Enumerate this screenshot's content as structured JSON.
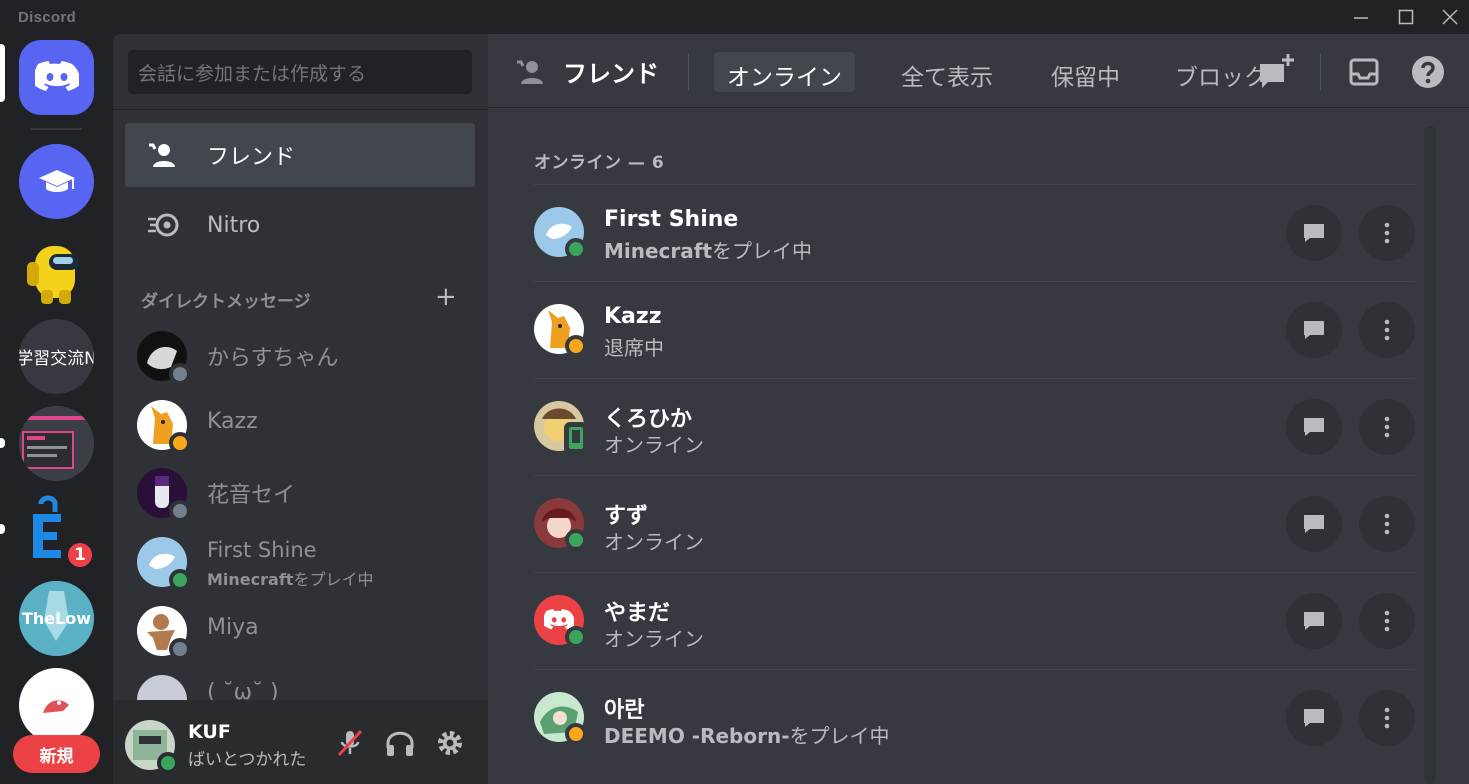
{
  "window": {
    "brand": "Discord"
  },
  "rail": {
    "servers": [
      {
        "name": "学習交流N",
        "label": "学習交流N"
      },
      {
        "name": "TheLow",
        "label": "TheLow"
      }
    ],
    "e_badge": "1",
    "new_label": "新規"
  },
  "sidebar": {
    "search_placeholder": "会話に参加または作成する",
    "nav": [
      {
        "label": "フレンド"
      },
      {
        "label": "Nitro"
      }
    ],
    "dm_header": "ダイレクトメッセージ",
    "dm_add": "+",
    "dms": [
      {
        "name": "からすちゃん",
        "status": "offline"
      },
      {
        "name": "Kazz",
        "status": "idle"
      },
      {
        "name": "花音セイ",
        "status": "offline"
      },
      {
        "name": "First Shine",
        "activity_game": "Minecraft",
        "activity_suffix": "をプレイ中",
        "status": "online"
      },
      {
        "name": "Miya",
        "status": "offline"
      },
      {
        "name": "( ˘ω˘ )",
        "status": "offline"
      }
    ]
  },
  "user": {
    "name": "KUF",
    "status_text": "ばいとつかれた"
  },
  "main": {
    "title": "フレンド",
    "tabs": [
      {
        "label": "オンライン",
        "active": true
      },
      {
        "label": "全て表示",
        "active": false
      },
      {
        "label": "保留中",
        "active": false
      },
      {
        "label": "ブロック",
        "active": false
      }
    ],
    "online_header": "オンライン — 6",
    "friends": [
      {
        "name": "First Shine",
        "game": "Minecraft",
        "sub": "をプレイ中",
        "status": "online"
      },
      {
        "name": "Kazz",
        "game": "",
        "sub": "退席中",
        "status": "idle"
      },
      {
        "name": "くろひか",
        "game": "",
        "sub": "オンライン",
        "status": "mobile"
      },
      {
        "name": "すず",
        "game": "",
        "sub": "オンライン",
        "status": "online"
      },
      {
        "name": "やまだ",
        "game": "",
        "sub": "オンライン",
        "status": "online"
      },
      {
        "name": "아란",
        "game": "DEEMO -Reborn-",
        "sub": "をプレイ中",
        "status": "idle"
      }
    ]
  },
  "colors": {
    "blurple": "#5865f2",
    "online": "#3ba55d",
    "idle": "#faa81a",
    "offline": "#747f8d",
    "danger": "#ed4245"
  }
}
